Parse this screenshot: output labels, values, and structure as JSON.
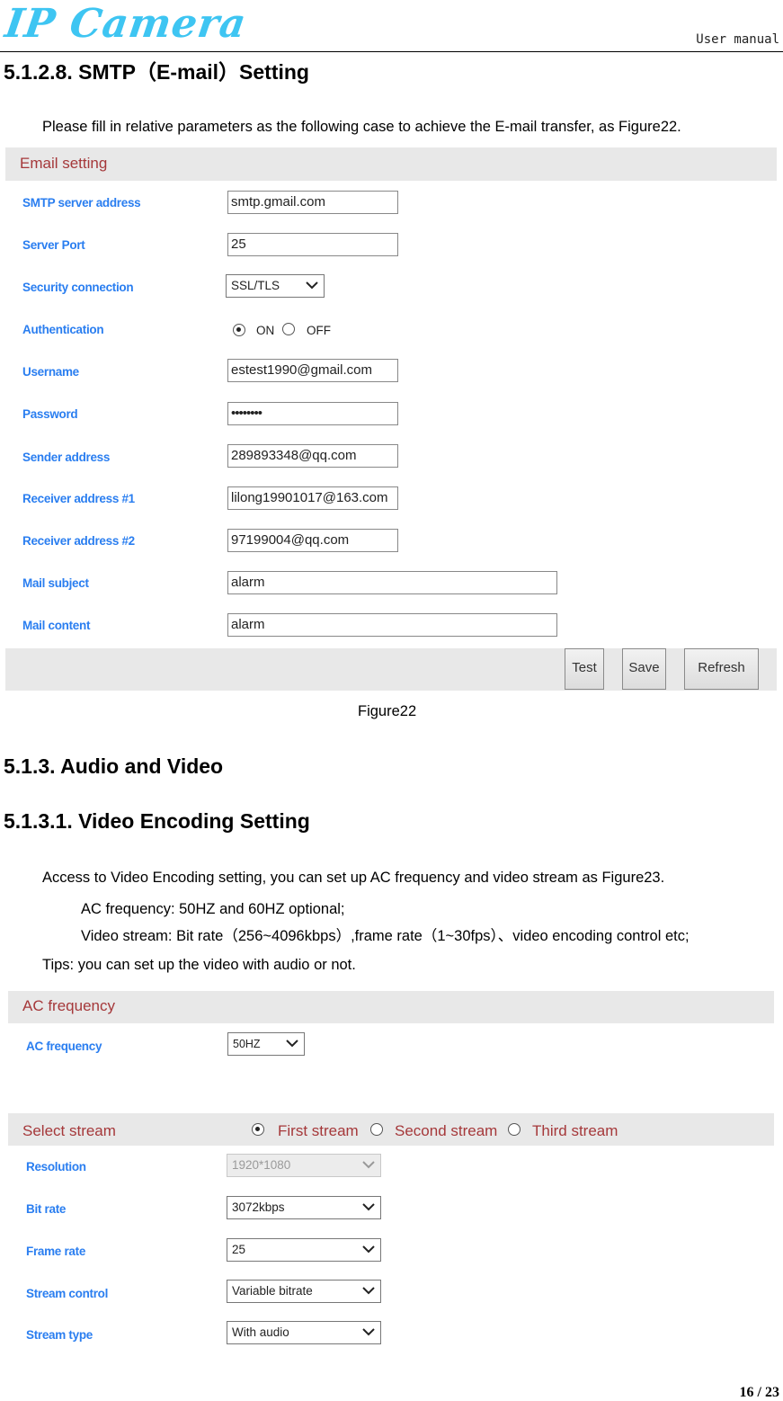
{
  "header": {
    "logo_text": "IP Camera",
    "doc_type": "User manual"
  },
  "sections": {
    "smtp_heading": "5.1.2.8. SMTP（E-mail）Setting",
    "smtp_intro": "Please fill in relative parameters as the following case to achieve the E-mail transfer, as Figure22.",
    "figure22_caption": "Figure22",
    "audio_video_heading": "5.1.3.  Audio and Video",
    "video_encoding_heading": "5.1.3.1. Video Encoding Setting",
    "video_intro": "Access to Video Encoding setting, you can set up AC frequency and video stream as Figure23.",
    "ac_note": "AC frequency: 50HZ and 60HZ optional;",
    "stream_note": "Video stream: Bit rate（256~4096kbps）,frame rate（1~30fps）、video encoding control etc;",
    "tips": "Tips: you can set up the video with audio or not."
  },
  "email_setting": {
    "title": "Email setting",
    "smtp_server": {
      "label": "SMTP server address",
      "value": "smtp.gmail.com"
    },
    "server_port": {
      "label": "Server Port",
      "value": "25"
    },
    "security": {
      "label": "Security connection",
      "value": "SSL/TLS"
    },
    "authentication": {
      "label": "Authentication",
      "options": [
        "ON",
        "OFF"
      ],
      "selected": "ON"
    },
    "username": {
      "label": "Username",
      "value": "estest1990@gmail.com"
    },
    "password": {
      "label": "Password",
      "value": "••••••••"
    },
    "sender": {
      "label": "Sender address",
      "value": "289893348@qq.com"
    },
    "receiver1": {
      "label": "Receiver address #1",
      "value": "lilong19901017@163.com"
    },
    "receiver2": {
      "label": "Receiver address #2",
      "value": "97199004@qq.com"
    },
    "mail_subject": {
      "label": "Mail subject",
      "value": "alarm"
    },
    "mail_content": {
      "label": "Mail content",
      "value": "alarm"
    },
    "buttons": {
      "test": "Test",
      "save": "Save",
      "refresh": "Refresh"
    }
  },
  "ac_frequency": {
    "title": "AC frequency",
    "label": "AC frequency",
    "value": "50HZ"
  },
  "select_stream": {
    "title": "Select stream",
    "options": [
      "First stream",
      "Second stream",
      "Third stream"
    ],
    "selected": "First stream",
    "resolution": {
      "label": "Resolution",
      "value": "1920*1080",
      "disabled": true
    },
    "bit_rate": {
      "label": "Bit rate",
      "value": "3072kbps"
    },
    "frame_rate": {
      "label": "Frame rate",
      "value": "25"
    },
    "stream_control": {
      "label": "Stream control",
      "value": "Variable bitrate"
    },
    "stream_type": {
      "label": "Stream type",
      "value": "With audio"
    }
  },
  "footer": {
    "page": "16 / 23"
  },
  "colors": {
    "logo": "#3ec5f2",
    "label_blue": "#2a7ef0",
    "section_red": "#a5383a",
    "bar_gray": "#e8e8e8"
  }
}
